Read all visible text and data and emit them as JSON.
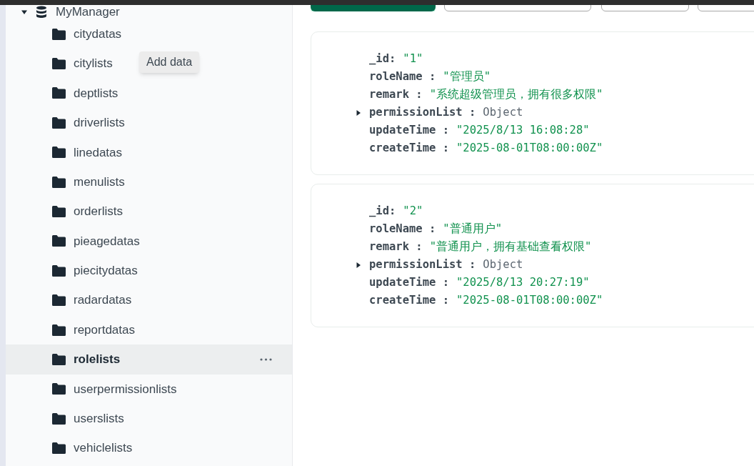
{
  "database": {
    "name": "MyManager",
    "expanded": true
  },
  "tooltip": "Add data",
  "collections": [
    {
      "name": "citydatas",
      "selected": false
    },
    {
      "name": "citylists",
      "selected": false
    },
    {
      "name": "deptlists",
      "selected": false
    },
    {
      "name": "driverlists",
      "selected": false
    },
    {
      "name": "linedatas",
      "selected": false
    },
    {
      "name": "menulists",
      "selected": false
    },
    {
      "name": "orderlists",
      "selected": false
    },
    {
      "name": "pieagedatas",
      "selected": false
    },
    {
      "name": "piecitydatas",
      "selected": false
    },
    {
      "name": "radardatas",
      "selected": false
    },
    {
      "name": "reportdatas",
      "selected": false
    },
    {
      "name": "rolelists",
      "selected": true
    },
    {
      "name": "userpermissionlists",
      "selected": false
    },
    {
      "name": "userslists",
      "selected": false
    },
    {
      "name": "vehiclelists",
      "selected": false
    }
  ],
  "toolbar_buttons": [
    {
      "selected": true
    },
    {
      "selected": false
    },
    {
      "selected": false
    },
    {
      "selected": false
    }
  ],
  "documents": [
    {
      "fields": [
        {
          "key": "_id:",
          "value": "\"1\"",
          "kind": "string"
        },
        {
          "key": "roleName :",
          "value": "\"管理员\"",
          "kind": "string"
        },
        {
          "key": "remark :",
          "value": "\"系统超级管理员，拥有很多权限\"",
          "kind": "string"
        },
        {
          "key": "permissionList :",
          "value": "Object",
          "kind": "object",
          "expanded": false
        },
        {
          "key": "updateTime :",
          "value": "\"2025/8/13 16:08:28\"",
          "kind": "string"
        },
        {
          "key": "createTime :",
          "value": "\"2025-08-01T08:00:00Z\"",
          "kind": "string"
        }
      ]
    },
    {
      "fields": [
        {
          "key": "_id:",
          "value": "\"2\"",
          "kind": "string"
        },
        {
          "key": "roleName :",
          "value": "\"普通用户\"",
          "kind": "string"
        },
        {
          "key": "remark :",
          "value": "\"普通用户，拥有基础查看权限\"",
          "kind": "string"
        },
        {
          "key": "permissionList :",
          "value": "Object",
          "kind": "object",
          "expanded": false
        },
        {
          "key": "updateTime :",
          "value": "\"2025/8/13 20:27:19\"",
          "kind": "string"
        },
        {
          "key": "createTime :",
          "value": "\"2025-08-01T08:00:00Z\"",
          "kind": "string"
        }
      ]
    }
  ]
}
